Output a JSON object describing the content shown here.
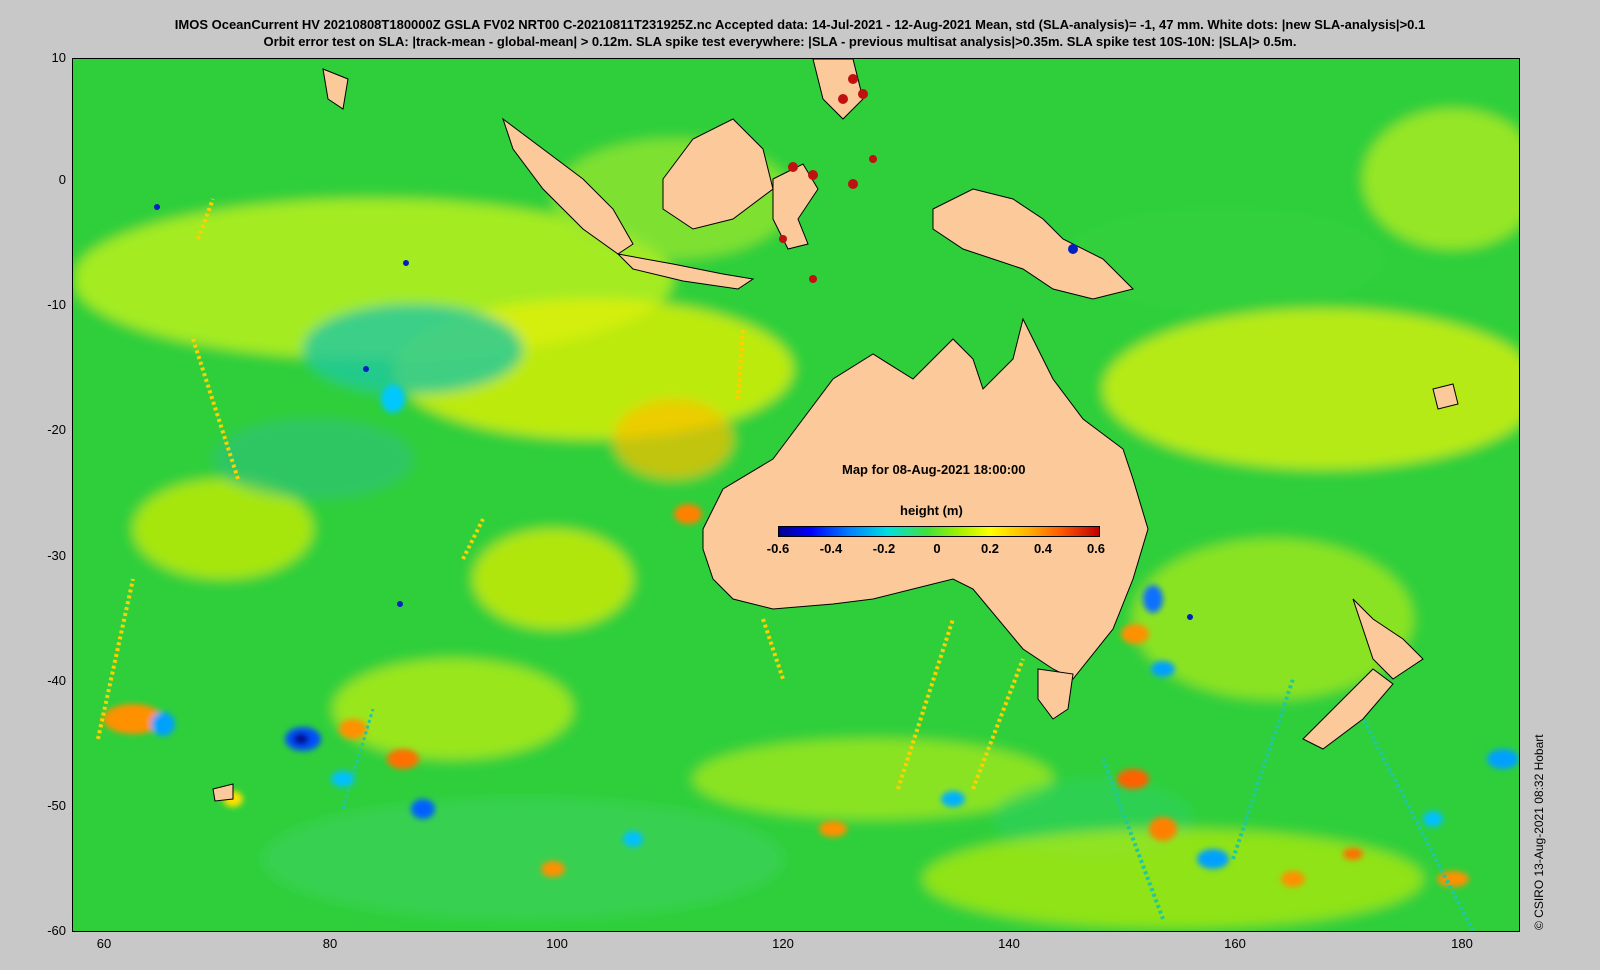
{
  "header": {
    "line1": "IMOS OceanCurrent HV 20210808T180000Z GSLA FV02 NRT00 C-20210811T231925Z.nc  Accepted data: 14-Jul-2021 - 12-Aug-2021 Mean, std (SLA-analysis)= -1, 47 mm. White dots: |new SLA-analysis|>0.1",
    "line2": "Orbit error test on SLA: |track-mean  - global-mean| > 0.12m.  SLA spike test everywhere: |SLA - previous multisat analysis|>0.35m. SLA spike test 10S-10N: |SLA|> 0.5m."
  },
  "axes": {
    "y_ticks": [
      "10",
      "0",
      "-10",
      "-20",
      "-30",
      "-40",
      "-50",
      "-60"
    ],
    "x_ticks": [
      "60",
      "80",
      "100",
      "120",
      "140",
      "160",
      "180"
    ]
  },
  "inset": {
    "title": "Map for 08-Aug-2021 18:00:00",
    "legend_title": "height (m)",
    "cbar_ticks": [
      "-0.6",
      "-0.4",
      "-0.2",
      "0",
      "0.2",
      "0.4",
      "0.6"
    ]
  },
  "credit": "©  CSIRO 13-Aug-2021 08:32 Hobart",
  "colors": {
    "background": "#c8c8c8",
    "ocean_base": "#2fcf3a",
    "land": "#fcc99b",
    "coast": "#000000"
  }
}
